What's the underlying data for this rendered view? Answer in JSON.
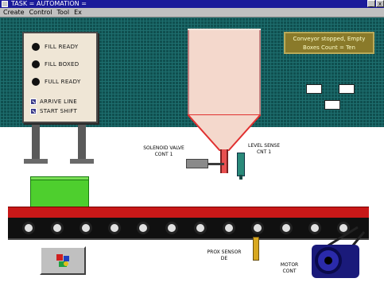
{
  "window": {
    "title": "TASK  =  AUTOMATION  =",
    "btn_min": "_",
    "btn_close": "x"
  },
  "menubar": {
    "items": [
      "Create",
      "Control",
      "Tool",
      "Ex"
    ]
  },
  "panel": {
    "lamps": [
      "FILL READY",
      "FILL BOXED",
      "FULL READY"
    ],
    "switches": [
      "ARRIVE LINE",
      "START SHIFT"
    ]
  },
  "status": {
    "line1": "Conveyor stopped, Empty",
    "line2": "Boxes Count = Ten"
  },
  "labels": {
    "valve": "SOLENOID VALVE\nCONT 1",
    "level": "LEVEL SENSE\nCNT 1",
    "prox": "PROX SENSOR\nDE",
    "motor": "MOTOR\nCONT"
  },
  "displays": {
    "a": "",
    "b": "",
    "c": ""
  },
  "colors": {
    "bg_teal": "#0f4f4f",
    "belt_red": "#c81818",
    "box_green": "#4ecf2e",
    "motor_blue": "#1a1a7a"
  }
}
